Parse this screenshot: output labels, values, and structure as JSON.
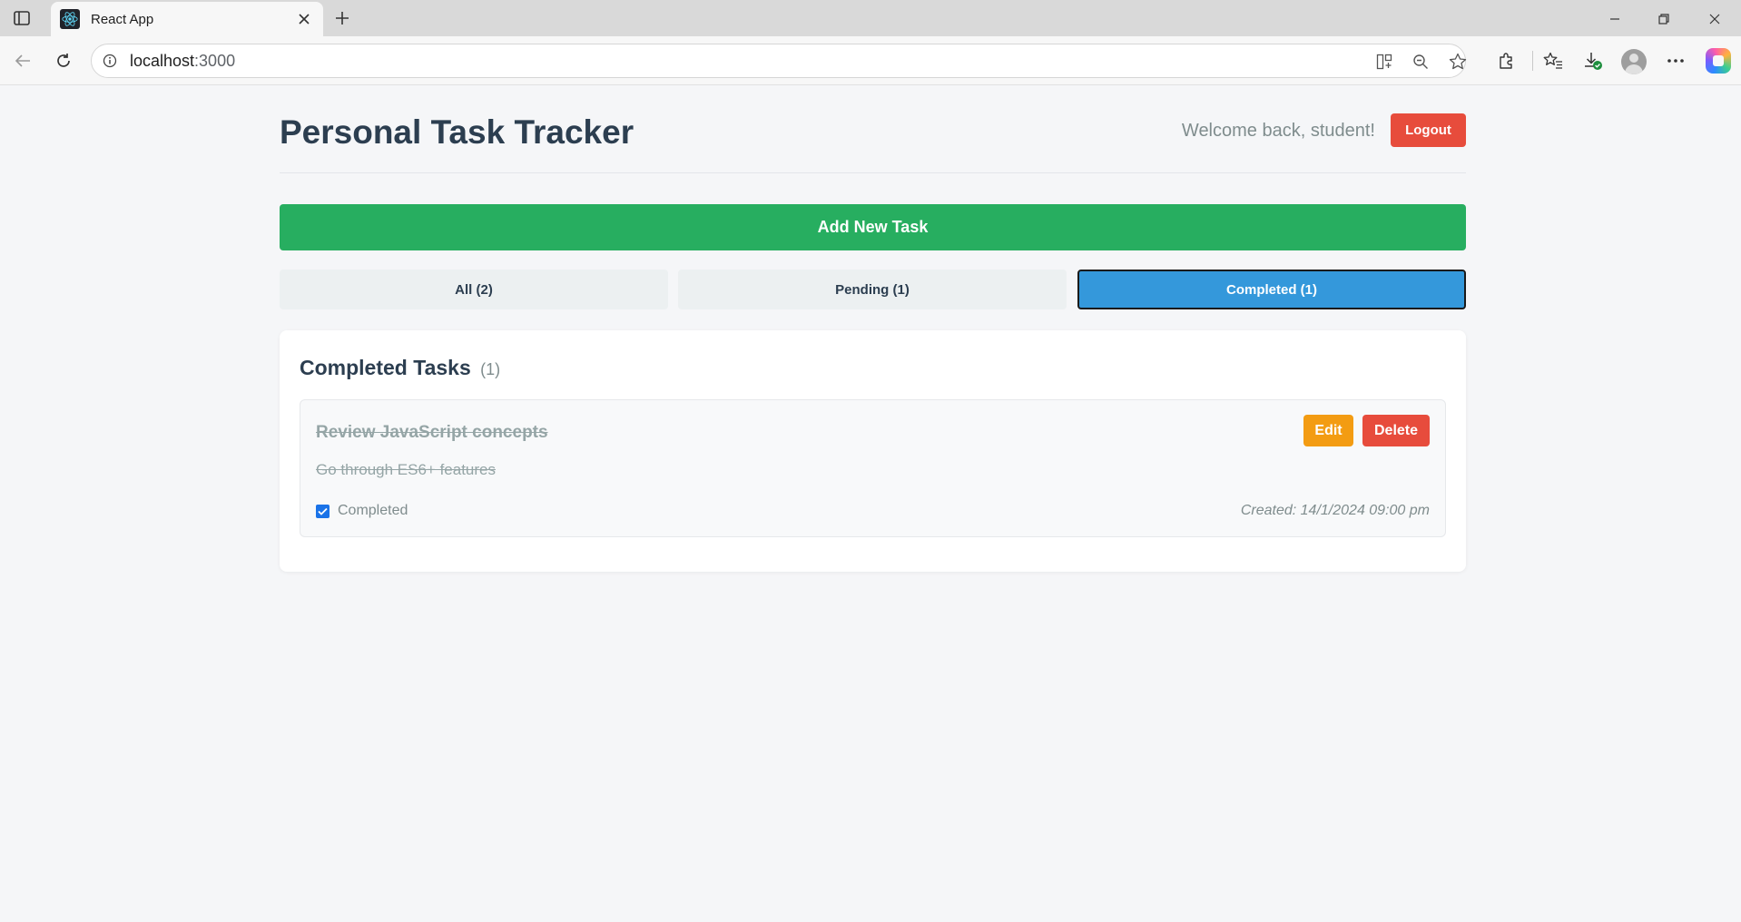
{
  "browser": {
    "tab_title": "React App",
    "url_host": "localhost",
    "url_port": ":3000"
  },
  "header": {
    "title": "Personal Task Tracker",
    "welcome": "Welcome back, student!",
    "logout_label": "Logout"
  },
  "add_task_label": "Add New Task",
  "filters": [
    {
      "label": "All (2)",
      "active": false
    },
    {
      "label": "Pending (1)",
      "active": false
    },
    {
      "label": "Completed (1)",
      "active": true
    }
  ],
  "task_list": {
    "heading": "Completed Tasks",
    "count": "(1)",
    "tasks": [
      {
        "title": "Review JavaScript concepts",
        "description": "Go through ES6+ features",
        "completed": true,
        "status_label": "Completed",
        "created": "Created: 14/1/2024 09:00 pm",
        "edit_label": "Edit",
        "delete_label": "Delete"
      }
    ]
  },
  "colors": {
    "add_button": "#27ae60",
    "logout_button": "#e74c3c",
    "active_filter": "#3498db",
    "edit_button": "#f39c12",
    "delete_button": "#e74c3c",
    "title_text": "#2c3e50"
  },
  "icons": {
    "tab": "react-logo-icon",
    "info": "info-icon",
    "back": "back-arrow-icon",
    "reload": "reload-icon"
  }
}
